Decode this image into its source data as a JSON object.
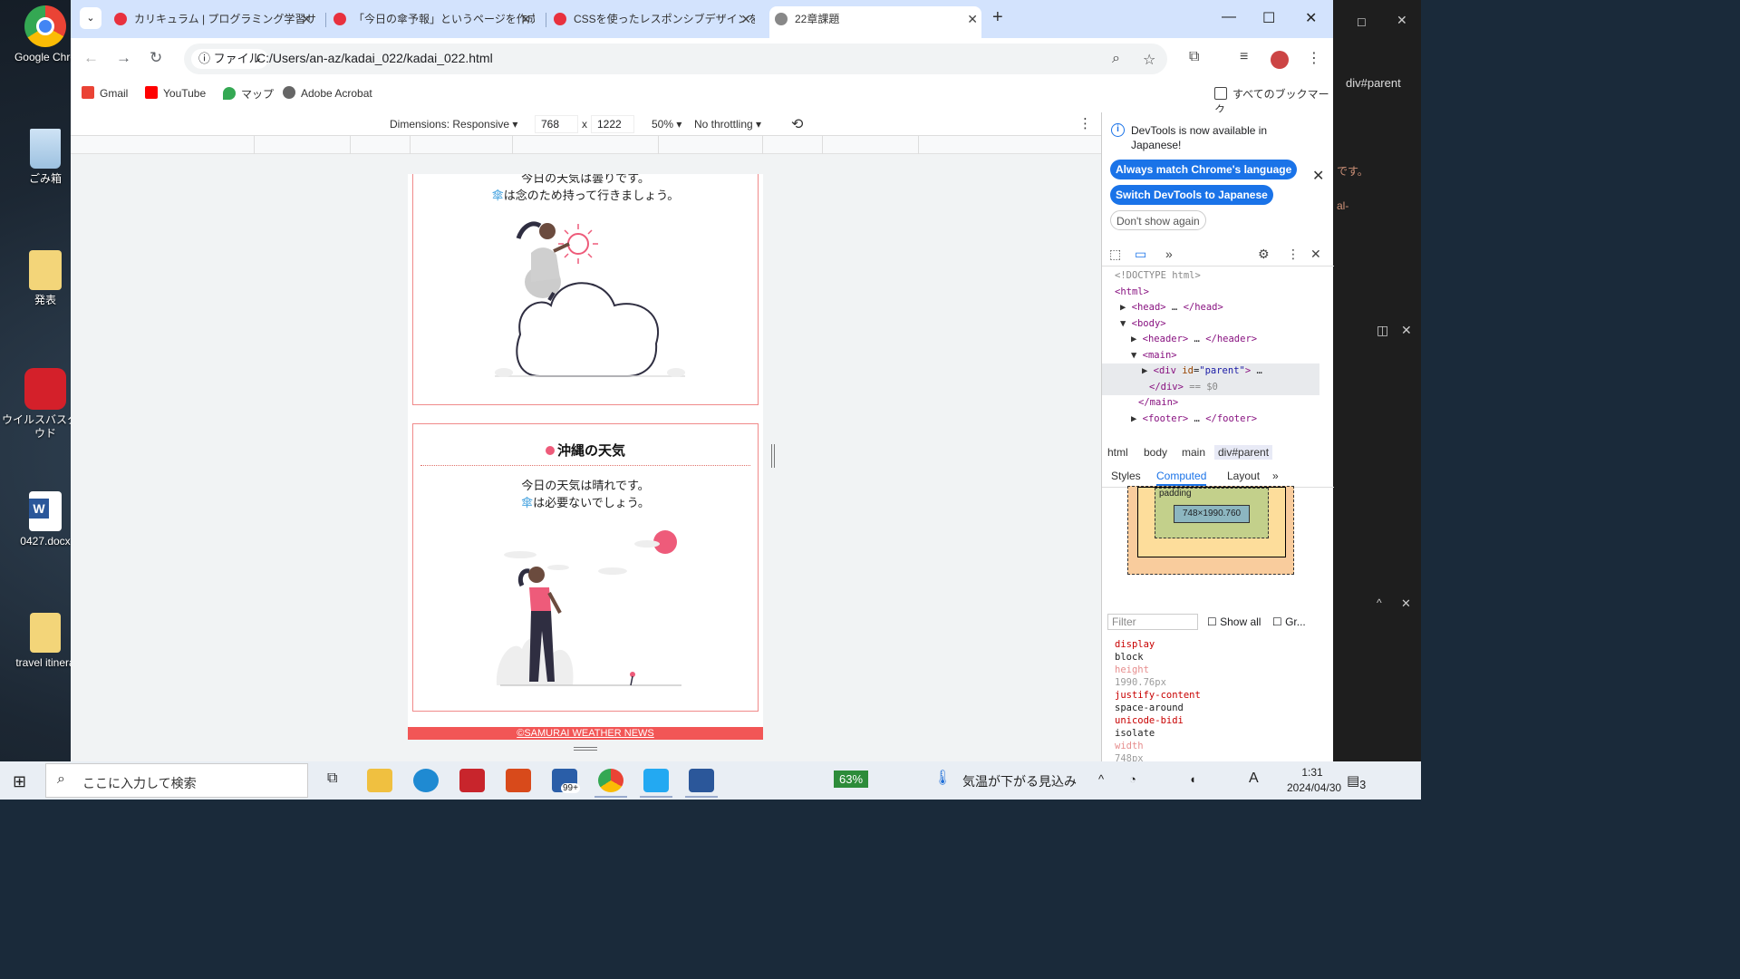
{
  "desktop": {
    "icons": [
      {
        "label": "Google Chro",
        "name": "chrome-desktop-icon"
      },
      {
        "label": "ごみ箱",
        "name": "recycle-bin-icon"
      },
      {
        "label": "発表",
        "name": "folder-happyo-icon"
      },
      {
        "label": "ウイルスバスター\nウド",
        "name": "virusbuster-icon"
      },
      {
        "label": "0427.docx",
        "name": "word-doc-icon"
      },
      {
        "label": "travel itinera",
        "name": "travel-folder-icon"
      }
    ]
  },
  "tabs": [
    {
      "title": "カリキュラム | プログラミング学習サイ",
      "active": false
    },
    {
      "title": "「今日の傘予報」というページを作成",
      "active": false
    },
    {
      "title": "CSSを使ったレスポンシブデザインを理",
      "active": false
    },
    {
      "title": "22章課題",
      "active": true
    }
  ],
  "toolbar": {
    "scheme_label": "ファイル",
    "url": "C:/Users/an-az/kadai_022/kadai_022.html"
  },
  "bookmarks": [
    {
      "label": "Gmail",
      "color": "#ea4335"
    },
    {
      "label": "YouTube",
      "color": "#ff0000"
    },
    {
      "label": "マップ",
      "color": "#34a853"
    },
    {
      "label": "Adobe Acrobat",
      "color": "#444444"
    }
  ],
  "bookmarks_all": "すべてのブックマーク",
  "device_toolbar": {
    "dimensions": "Dimensions: Responsive ▾",
    "width": "768",
    "times": "x",
    "height": "1222",
    "zoom": "50% ▾",
    "throttling": "No throttling ▾"
  },
  "page": {
    "card1": {
      "line1": "今日の天気は曇りです。",
      "umbrella": "傘",
      "line2_rest": "は念のため持って行きましょう。"
    },
    "card2": {
      "title": "沖縄の天気",
      "line1": "今日の天気は晴れです。",
      "umbrella": "傘",
      "line2_rest": "は必要ないでしょう。"
    },
    "footer": "©SAMURAI WEATHER NEWS"
  },
  "devtools": {
    "banner": "DevTools is now available in Japanese!",
    "btn_match": "Always match Chrome's language",
    "btn_switch": "Switch DevTools to Japanese",
    "btn_dont": "Don't show again",
    "breadcrumbs": [
      "html",
      "body",
      "main",
      "div#parent"
    ],
    "subtabs": [
      "Styles",
      "Computed",
      "Layout"
    ],
    "box_label": "padding",
    "box_content": "748×1990.760",
    "filter_placeholder": "Filter",
    "show_all": "Show all",
    "group": "Gr...",
    "props": [
      {
        "name": "display",
        "value": "block",
        "faded": false
      },
      {
        "name": "height",
        "value": "1990.76px",
        "faded": true
      },
      {
        "name": "justify-content",
        "value": "space-around",
        "faded": false
      },
      {
        "name": "unicode-bidi",
        "value": "isolate",
        "faded": false
      },
      {
        "name": "width",
        "value": "748px",
        "faded": true
      }
    ]
  },
  "right_panel": {
    "title": "div#parent"
  },
  "taskbar": {
    "search_placeholder": "ここに入力して検索",
    "battery": "63%",
    "weather": "気温が下がる見込み",
    "ime": "A",
    "time": "1:31",
    "date": "2024/04/30",
    "notif": "3",
    "mail_badge": "99+"
  }
}
